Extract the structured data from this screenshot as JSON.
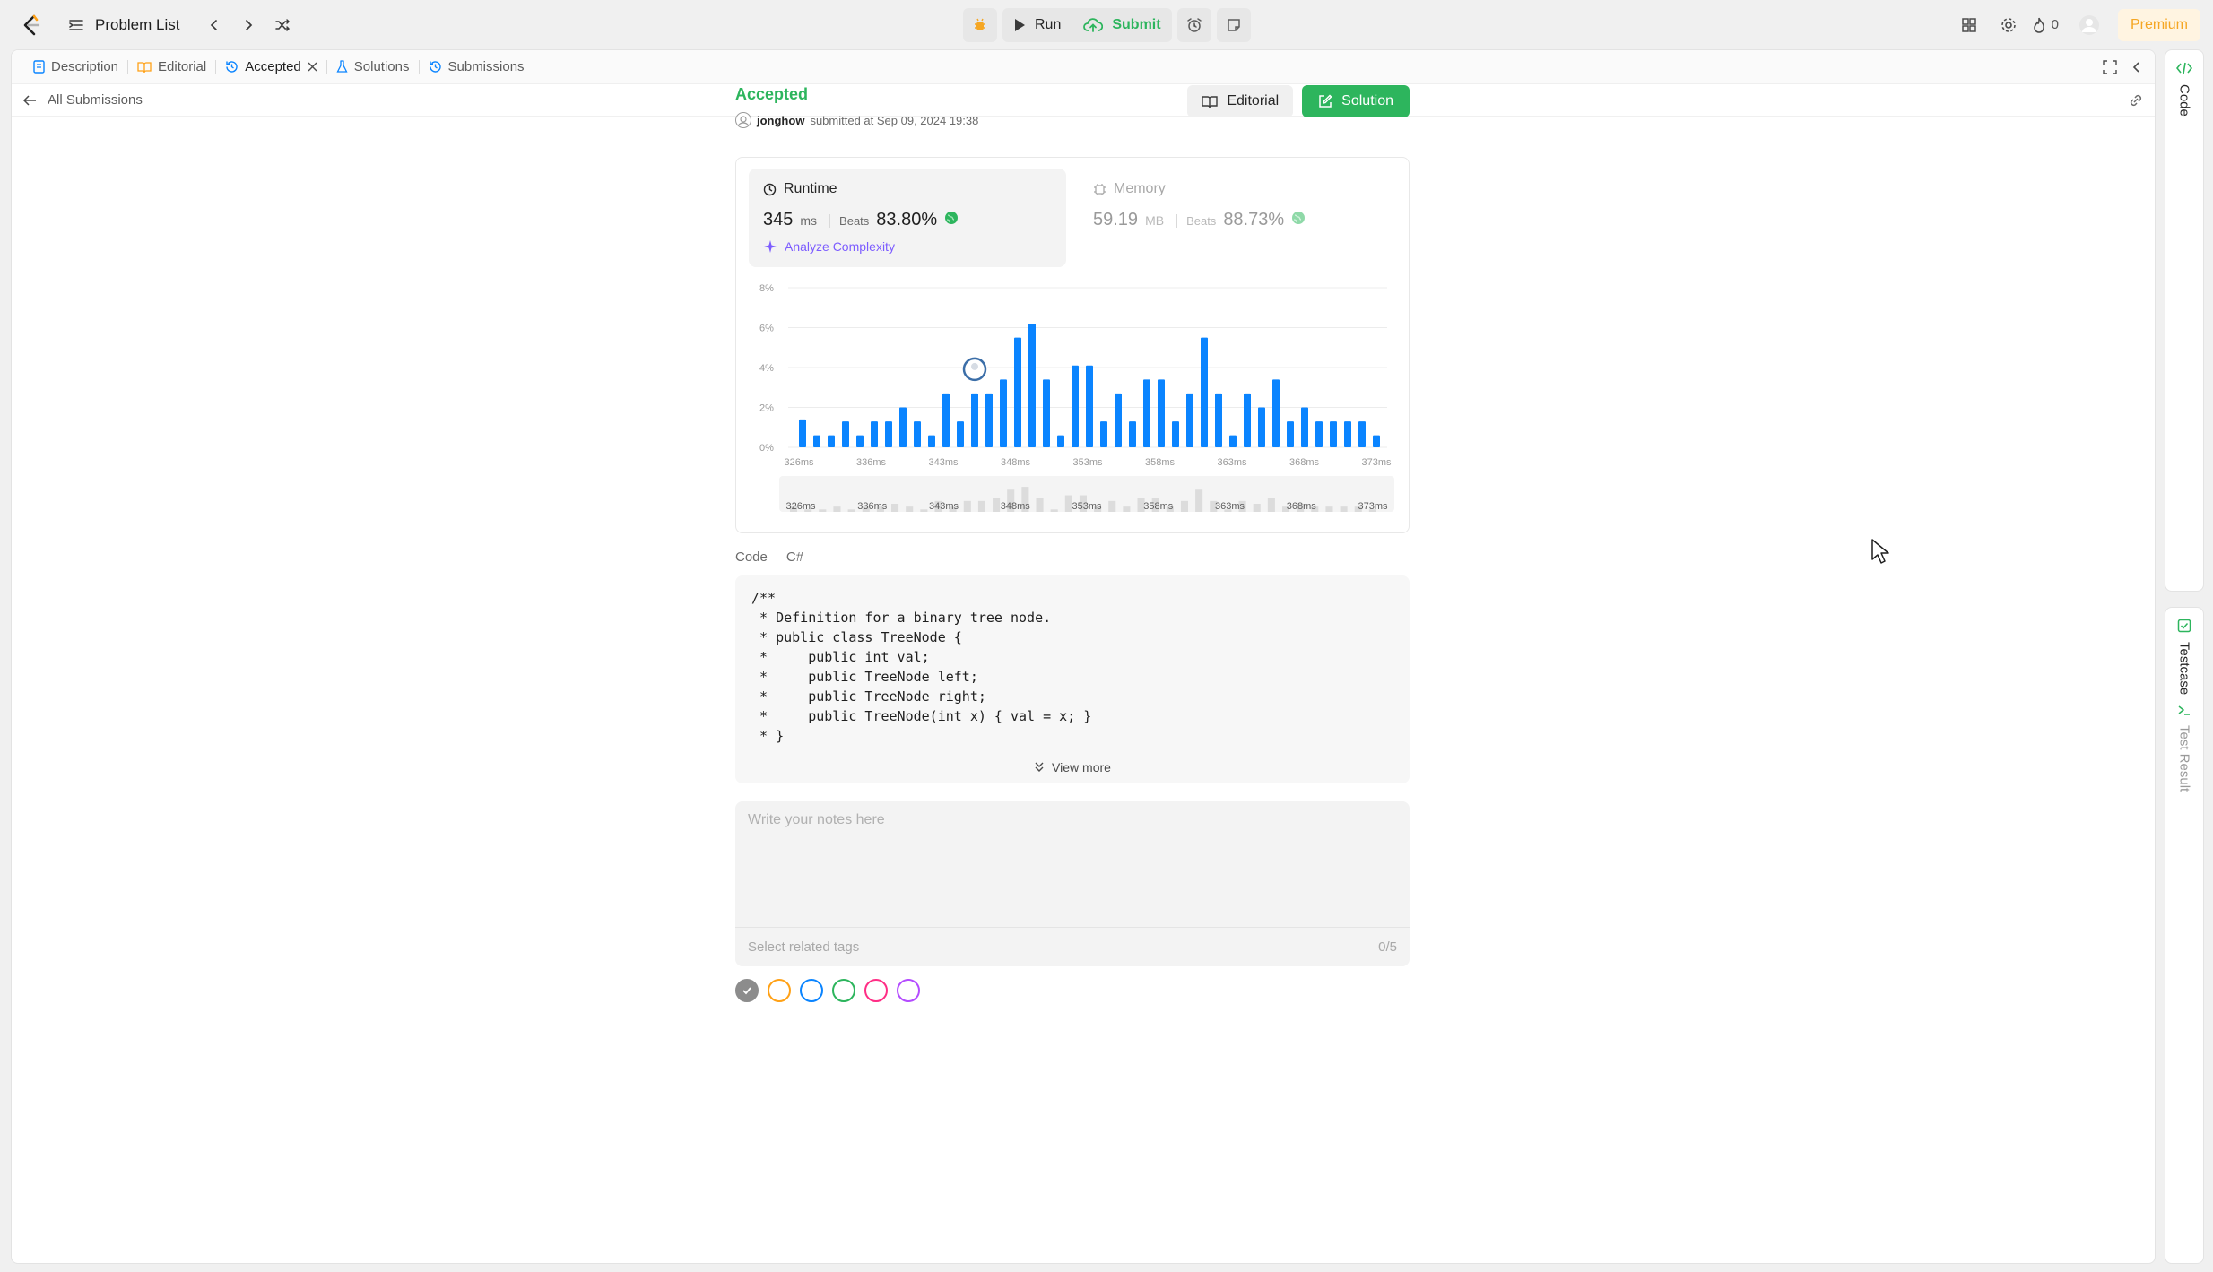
{
  "topbar": {
    "problem_list": "Problem List",
    "run_label": "Run",
    "submit_label": "Submit",
    "streak_count": "0",
    "premium_label": "Premium"
  },
  "tabs": [
    {
      "label": "Description"
    },
    {
      "label": "Editorial"
    },
    {
      "label": "Accepted"
    },
    {
      "label": "Solutions"
    },
    {
      "label": "Submissions"
    }
  ],
  "breadcrumb": {
    "back_label": "All Submissions"
  },
  "submission": {
    "status": "Accepted",
    "user": "jonghow",
    "submitted_text": "submitted at Sep 09, 2024 19:38",
    "editorial_btn": "Editorial",
    "solution_btn": "Solution"
  },
  "runtime": {
    "title": "Runtime",
    "value": "345",
    "unit": "ms",
    "beats_label": "Beats",
    "beats_pct": "83.80%",
    "analyze_label": "Analyze Complexity"
  },
  "memory": {
    "title": "Memory",
    "value": "59.19",
    "unit": "MB",
    "beats_label": "Beats",
    "beats_pct": "88.73%"
  },
  "chart_data": {
    "type": "bar",
    "ylim": [
      0,
      8
    ],
    "y_ticks": [
      "0%",
      "2%",
      "4%",
      "6%",
      "8%"
    ],
    "x_ticks": [
      "326ms",
      "336ms",
      "343ms",
      "348ms",
      "353ms",
      "358ms",
      "363ms",
      "368ms",
      "373ms"
    ],
    "values": [
      1.4,
      0.6,
      0.6,
      1.3,
      0.6,
      1.3,
      1.3,
      2.0,
      1.3,
      0.6,
      2.7,
      1.3,
      2.7,
      2.7,
      3.4,
      5.5,
      6.2,
      3.4,
      0.6,
      4.1,
      4.1,
      1.3,
      2.7,
      1.3,
      3.4,
      3.4,
      1.3,
      2.7,
      5.5,
      2.7,
      0.6,
      2.7,
      2.0,
      3.4,
      1.3,
      2.0,
      1.3,
      1.3,
      1.3,
      1.3,
      0.6
    ],
    "highlight_index": 12,
    "grid": true,
    "bar_color": "#0a84ff",
    "overview_ticks": [
      "326ms",
      "336ms",
      "343ms",
      "348ms",
      "353ms",
      "358ms",
      "363ms",
      "368ms",
      "373ms"
    ]
  },
  "code": {
    "label": "Code",
    "language": "C#",
    "lines": [
      "/**",
      " * Definition for a binary tree node.",
      " * public class TreeNode {",
      " *     public int val;",
      " *     public TreeNode left;",
      " *     public TreeNode right;",
      " *     public TreeNode(int x) { val = x; }",
      " * }"
    ],
    "view_more": "View more"
  },
  "notes": {
    "placeholder": "Write your notes here",
    "tags_placeholder": "Select related tags",
    "tags_count": "0/5"
  },
  "note_colors": [
    "#8c8c8c",
    "#ffa116",
    "#0a84ff",
    "#2db55d",
    "#ff2d85",
    "#b44cff"
  ],
  "rail": {
    "code_label": "Code",
    "testcase_label": "Testcase",
    "test_result_label": "Test Result"
  },
  "colors": {
    "accent_green": "#2db55d",
    "chart_blue": "#0a84ff",
    "premium_orange": "#f5a623",
    "analyze_purple": "#7c5cff"
  }
}
